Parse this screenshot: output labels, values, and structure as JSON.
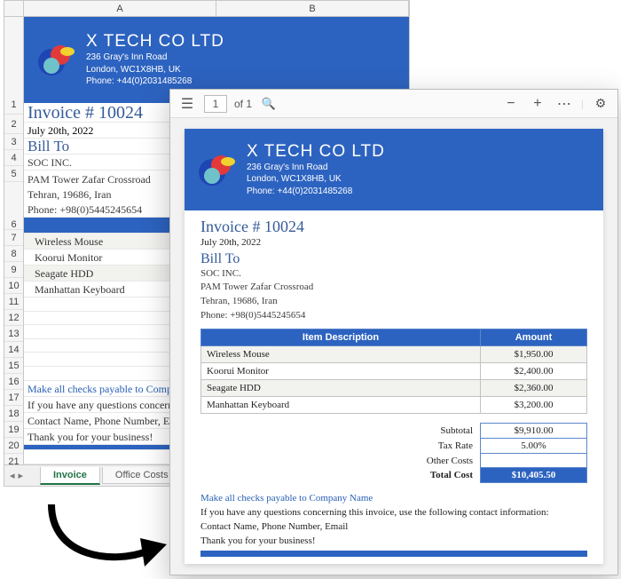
{
  "company": {
    "name": "X TECH CO LTD",
    "addr1": "236 Gray's Inn Road",
    "addr2": "London, WC1X8HB, UK",
    "phone": "Phone: +44(0)2031485268"
  },
  "invoice": {
    "number_label": "Invoice # 10024",
    "date": "July 20th, 2022"
  },
  "bill_to": {
    "heading": "Bill To",
    "name": "SOC INC.",
    "addr1": "PAM Tower Zafar Crossroad",
    "addr2": "Tehran, 19686, Iran",
    "phone": "Phone: +98(0)5445245654"
  },
  "table": {
    "col_desc": "Item Description",
    "col_amount": "Amount",
    "head_excel_trunc": "Item Description",
    "rows": [
      {
        "desc": "Wireless Mouse",
        "amount": "$1,950.00"
      },
      {
        "desc": "Koorui Monitor",
        "amount": "$2,400.00"
      },
      {
        "desc": "Seagate HDD",
        "amount": "$2,360.00"
      },
      {
        "desc": "Manhattan Keyboard",
        "amount": "$3,200.00"
      }
    ]
  },
  "summary": {
    "subtotal_lbl": "Subtotal",
    "subtotal": "$9,910.00",
    "tax_lbl": "Tax Rate",
    "tax": "5.00%",
    "other_lbl": "Other Costs",
    "other": "",
    "total_lbl": "Total Cost",
    "total": "$10,405.50"
  },
  "footer": {
    "payable_full": "Make all checks payable to Company Name",
    "payable_trunc": "Make all checks payable to Company N",
    "contact_full": "If you have any questions concerning this invoice, use the following contact information:",
    "contact_trunc": "If you have any questions concerning this",
    "contact2": "Contact Name, Phone Number, Email",
    "thanks": "Thank you for your business!"
  },
  "spreadsheet": {
    "cols": [
      "A",
      "B"
    ],
    "row_count": 23,
    "tabs": {
      "invoice": "Invoice",
      "office_costs": "Office Costs"
    }
  },
  "pdf": {
    "page": "1",
    "of": "of 1"
  }
}
